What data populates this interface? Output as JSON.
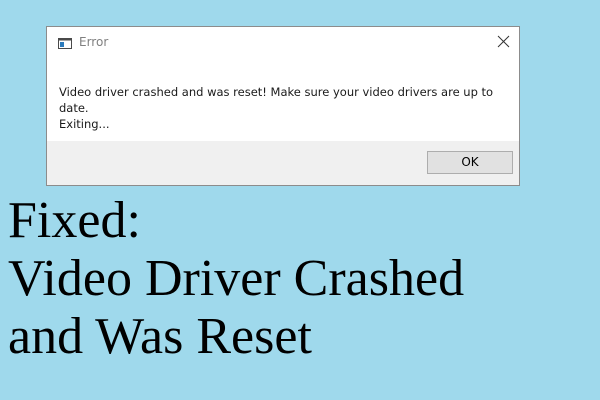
{
  "dialog": {
    "title": "Error",
    "message_line1": "Video driver crashed and was reset!  Make sure your video drivers are up to date.",
    "message_line2": "Exiting...",
    "ok_label": "OK",
    "icons": {
      "app": "window-icon",
      "close": "close-icon"
    }
  },
  "headline": {
    "line1": "Fixed:",
    "line2": "Video Driver Crashed",
    "line3": "and Was Reset"
  },
  "colors": {
    "background": "#9fd9ec",
    "dialog_footer": "#f0f0f0",
    "button": "#e1e1e1"
  }
}
